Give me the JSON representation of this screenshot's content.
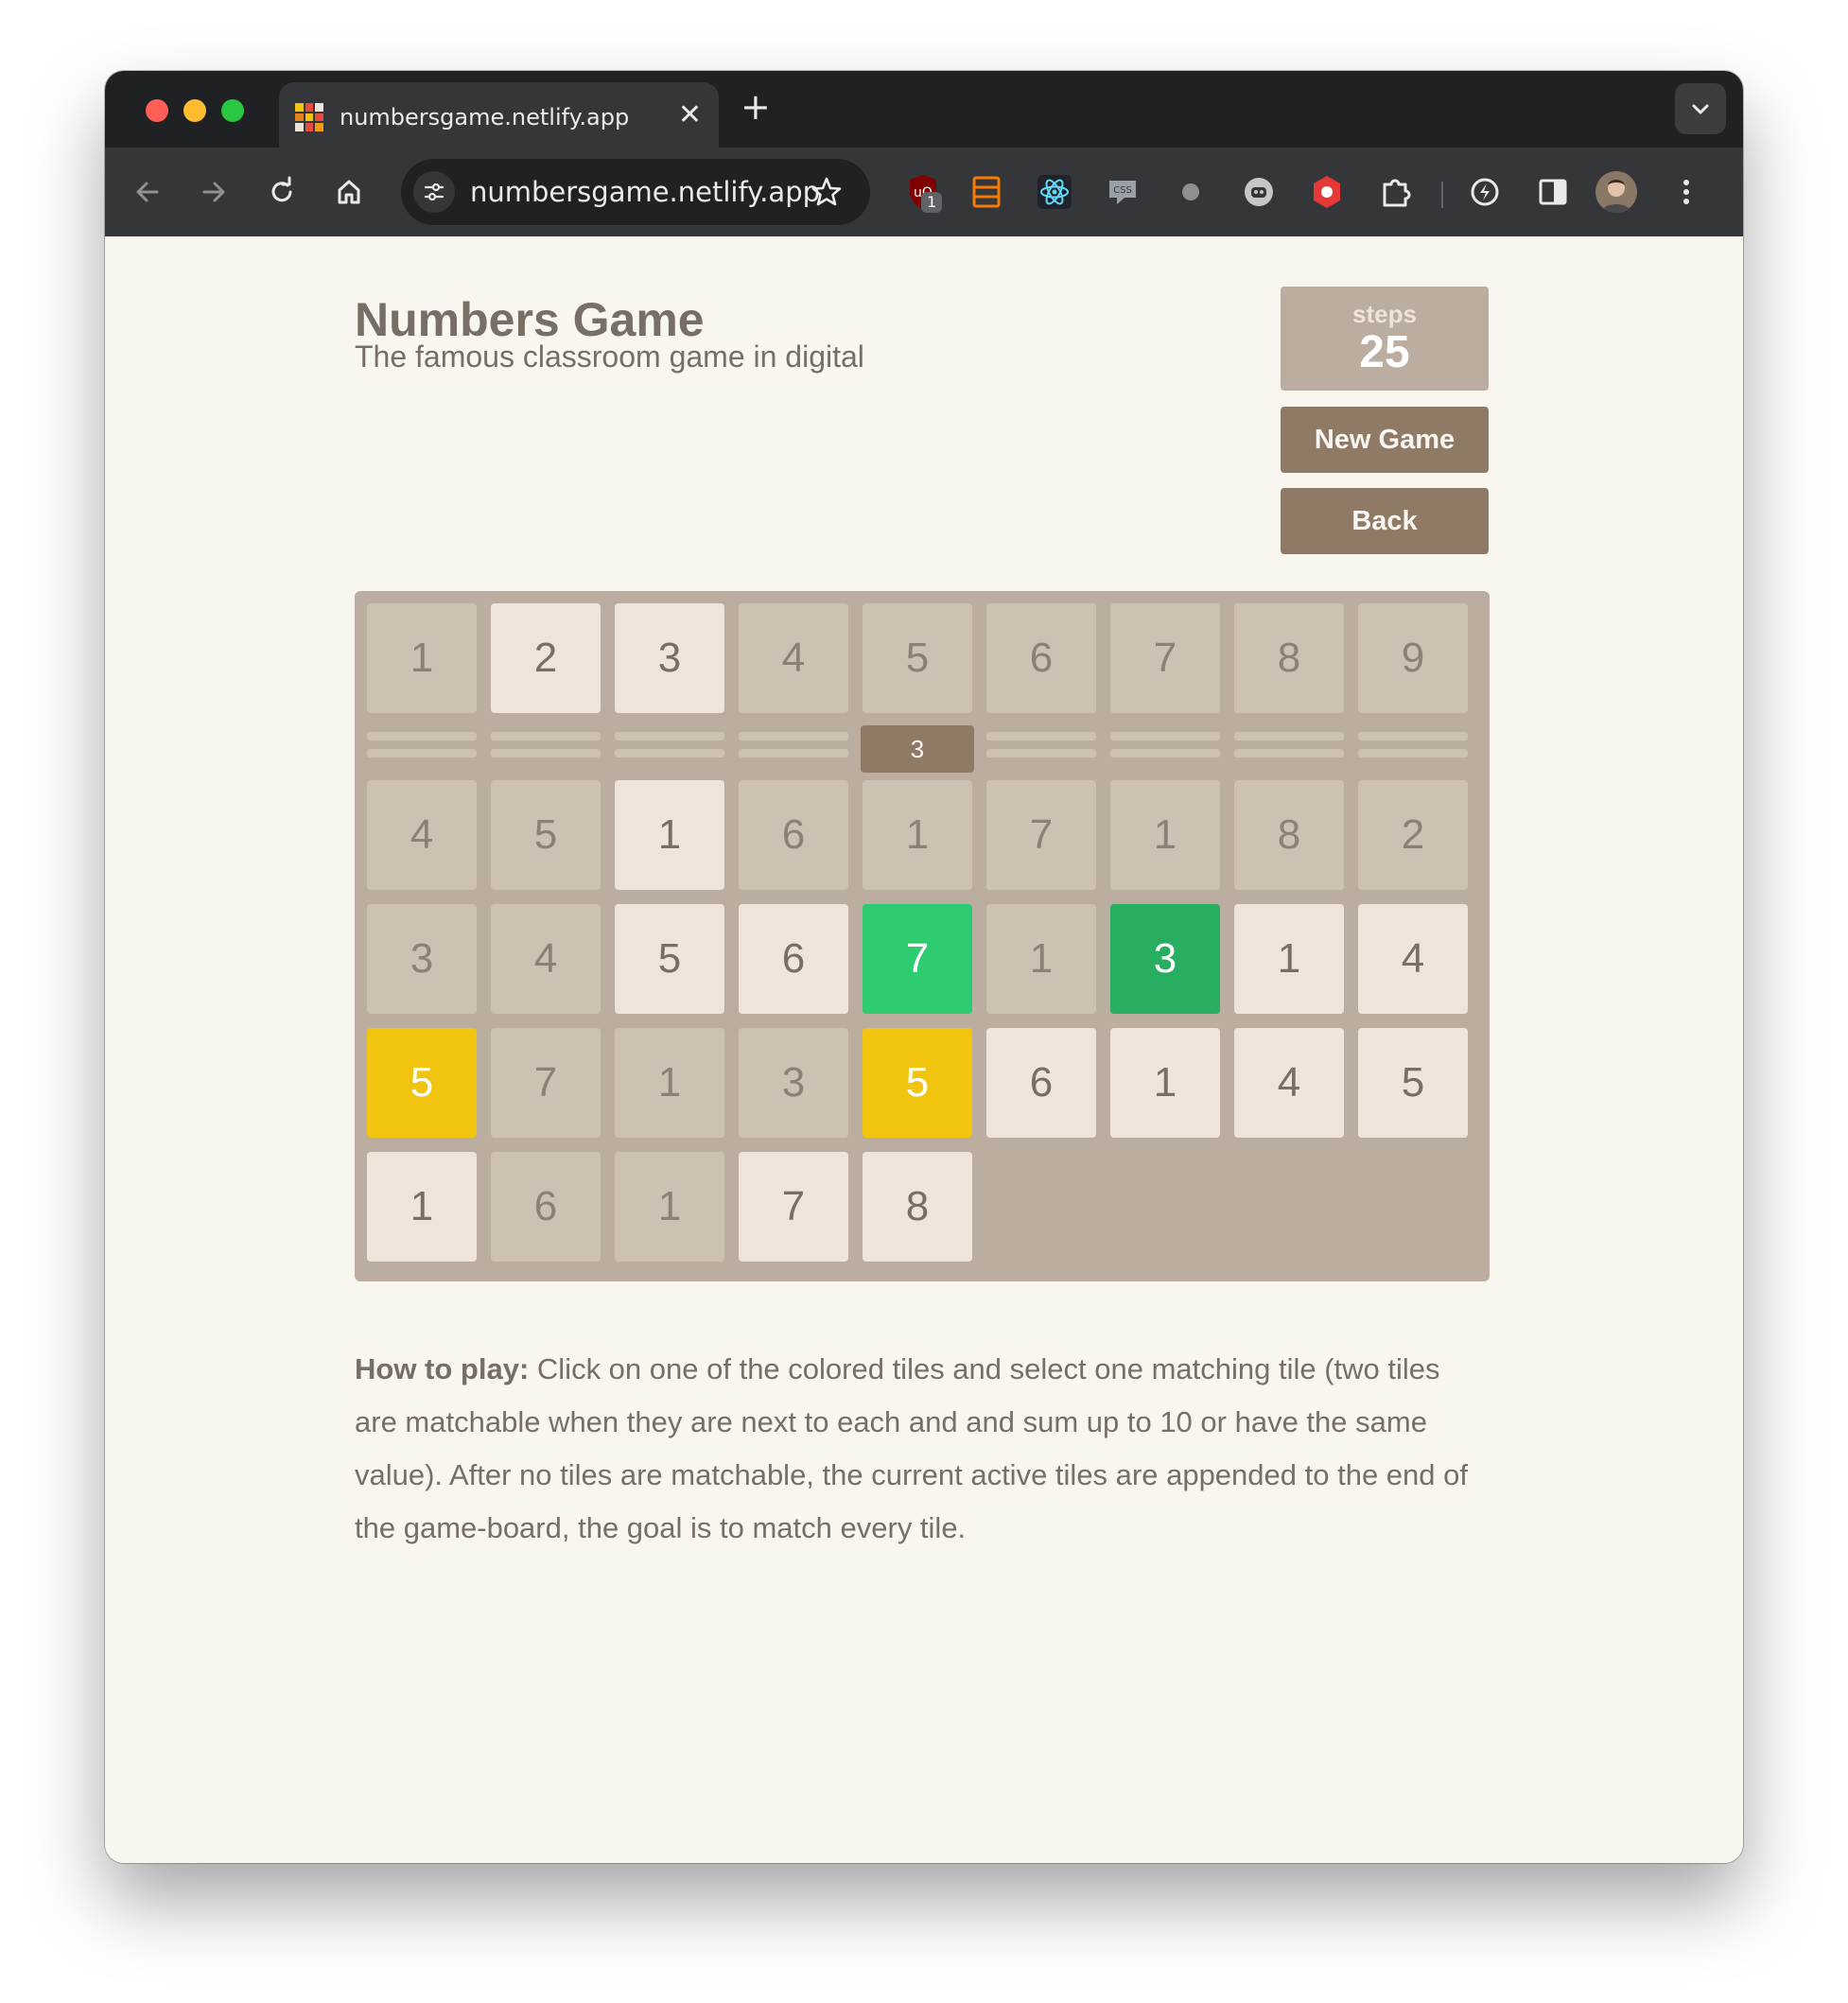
{
  "browser": {
    "tab_title": "numbersgame.netlify.app",
    "tab_close_icon": "close-icon",
    "new_tab_symbol": "+",
    "url": "numbersgame.netlify.app",
    "extension_badge": "1"
  },
  "header": {
    "title": "Numbers Game",
    "subtitle": "The famous classroom game in digital"
  },
  "score": {
    "label": "steps",
    "value": "25"
  },
  "buttons": {
    "new_game": "New Game",
    "back": "Back"
  },
  "board": {
    "columns": 9,
    "rows": [
      {
        "tiles": [
          {
            "value": "1",
            "state": "inactive"
          },
          {
            "value": "2",
            "state": "active"
          },
          {
            "value": "3",
            "state": "active"
          },
          {
            "value": "4",
            "state": "inactive"
          },
          {
            "value": "5",
            "state": "inactive"
          },
          {
            "value": "6",
            "state": "inactive"
          },
          {
            "value": "7",
            "state": "inactive"
          },
          {
            "value": "8",
            "state": "inactive"
          },
          {
            "value": "9",
            "state": "inactive"
          }
        ]
      },
      {
        "collapsed": true,
        "collapsed_count": "3"
      },
      {
        "tiles": [
          {
            "value": "4",
            "state": "inactive"
          },
          {
            "value": "5",
            "state": "inactive"
          },
          {
            "value": "1",
            "state": "active"
          },
          {
            "value": "6",
            "state": "inactive"
          },
          {
            "value": "1",
            "state": "inactive"
          },
          {
            "value": "7",
            "state": "inactive"
          },
          {
            "value": "1",
            "state": "inactive"
          },
          {
            "value": "8",
            "state": "inactive"
          },
          {
            "value": "2",
            "state": "inactive"
          }
        ]
      },
      {
        "tiles": [
          {
            "value": "3",
            "state": "inactive"
          },
          {
            "value": "4",
            "state": "inactive"
          },
          {
            "value": "5",
            "state": "active"
          },
          {
            "value": "6",
            "state": "active"
          },
          {
            "value": "7",
            "state": "green"
          },
          {
            "value": "1",
            "state": "inactive"
          },
          {
            "value": "3",
            "state": "darkgreen"
          },
          {
            "value": "1",
            "state": "active"
          },
          {
            "value": "4",
            "state": "active"
          }
        ]
      },
      {
        "tiles": [
          {
            "value": "5",
            "state": "yellow"
          },
          {
            "value": "7",
            "state": "inactive"
          },
          {
            "value": "1",
            "state": "inactive"
          },
          {
            "value": "3",
            "state": "inactive"
          },
          {
            "value": "5",
            "state": "yellow"
          },
          {
            "value": "6",
            "state": "active"
          },
          {
            "value": "1",
            "state": "active"
          },
          {
            "value": "4",
            "state": "active"
          },
          {
            "value": "5",
            "state": "active"
          }
        ]
      },
      {
        "tiles": [
          {
            "value": "1",
            "state": "active"
          },
          {
            "value": "6",
            "state": "inactive"
          },
          {
            "value": "1",
            "state": "inactive"
          },
          {
            "value": "7",
            "state": "active"
          },
          {
            "value": "8",
            "state": "active"
          }
        ]
      }
    ]
  },
  "instructions": {
    "label": "How to play:",
    "text": "Click on one of the colored tiles and select one matching tile (two tiles are matchable when they are next to each and and sum up to 10 or have the same value). After no tiles are matchable, the current active tiles are appended to the end of the game-board, the goal is to match every tile."
  },
  "colors": {
    "board_bg": "#bbada0",
    "tile_inactive": "#cdc1b4",
    "tile_active": "#eee4da",
    "tile_green": "#2ecc71",
    "tile_darkgreen": "#27ae60",
    "tile_yellow": "#f1c40f",
    "button": "#8f7a66",
    "text": "#776e65"
  }
}
